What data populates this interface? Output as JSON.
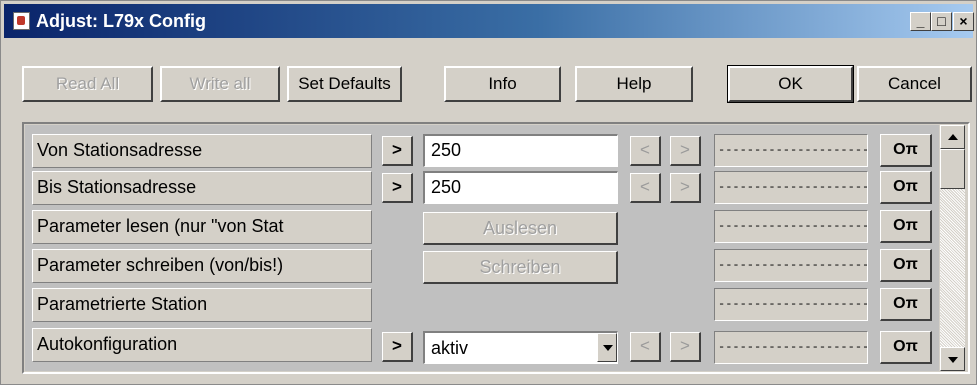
{
  "window": {
    "title": "Adjust: L79x Config",
    "controls": {
      "minimize": "_",
      "maximize": "□",
      "close": "×"
    }
  },
  "toolbar": {
    "read_all": "Read All",
    "write_all": "Write all",
    "set_defaults": "Set Defaults",
    "info": "Info",
    "help": "Help",
    "ok": "OK",
    "cancel": "Cancel"
  },
  "rows": [
    {
      "label": "Von Stationsadresse",
      "send": ">",
      "value": "250",
      "prev": "<",
      "next": ">",
      "status": "----------------------",
      "key": "Oπ"
    },
    {
      "label": "Bis Stationsadresse",
      "send": ">",
      "value": "250",
      "prev": "<",
      "next": ">",
      "status": "----------------------",
      "key": "Oπ"
    },
    {
      "label": "Parameter lesen (nur \"von Stat",
      "action": "Auslesen",
      "status": "----------------------",
      "key": "Oπ"
    },
    {
      "label": "Parameter schreiben (von/bis!)",
      "action": "Schreiben",
      "status": "----------------------",
      "key": "Oπ"
    },
    {
      "label": "Parametrierte Station",
      "status": "----------------------",
      "key": "Oπ"
    },
    {
      "label": "Autokonfiguration",
      "send": ">",
      "value": "aktiv",
      "prev": "<",
      "next": ">",
      "status": "----------------------",
      "key": "Oπ"
    }
  ],
  "icons": {
    "app": "app-icon",
    "key": "key-icon",
    "scroll_up": "scroll-up-icon",
    "scroll_down": "scroll-down-icon",
    "dropdown": "chevron-down-icon"
  }
}
